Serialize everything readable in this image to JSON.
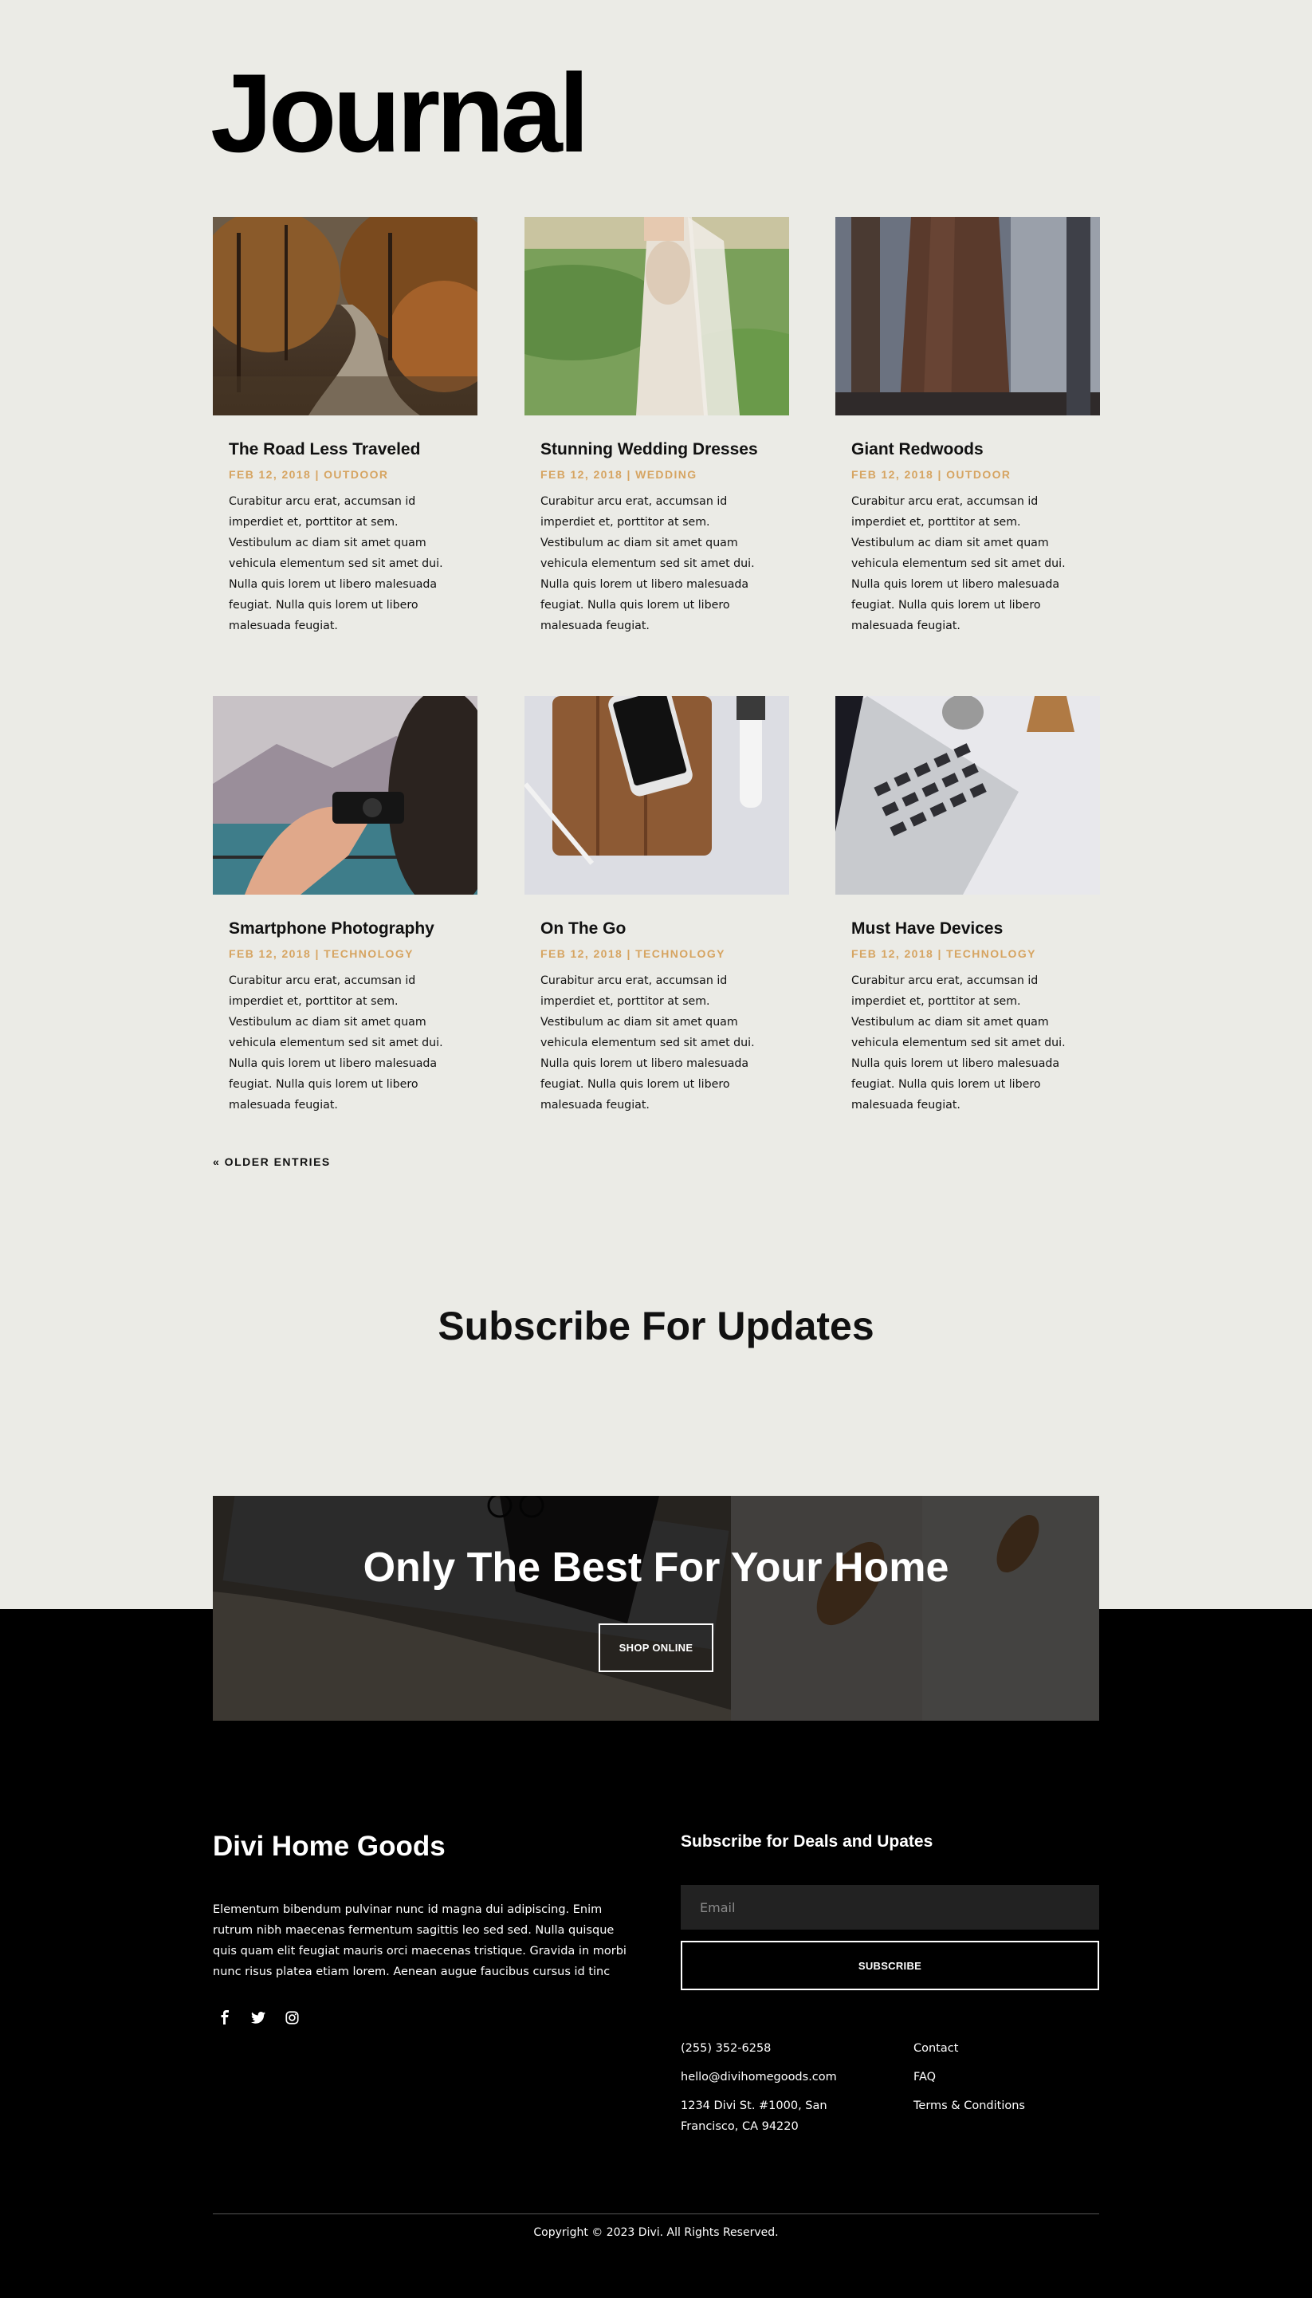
{
  "page": {
    "title": "Journal"
  },
  "posts": [
    {
      "title": "The Road Less Traveled",
      "meta": "FEB 12, 2018 | OUTDOOR",
      "excerpt": "Curabitur arcu erat, accumsan id imperdiet et, porttitor at sem. Vestibulum ac diam sit amet quam vehicula elementum sed sit amet dui. Nulla quis lorem ut libero malesuada feugiat. Nulla quis lorem ut libero malesuada feugiat."
    },
    {
      "title": "Stunning Wedding Dresses",
      "meta": "FEB 12, 2018 | WEDDING",
      "excerpt": "Curabitur arcu erat, accumsan id imperdiet et, porttitor at sem. Vestibulum ac diam sit amet quam vehicula elementum sed sit amet dui. Nulla quis lorem ut libero malesuada feugiat. Nulla quis lorem ut libero malesuada feugiat."
    },
    {
      "title": "Giant Redwoods",
      "meta": "FEB 12, 2018 | OUTDOOR",
      "excerpt": "Curabitur arcu erat, accumsan id imperdiet et, porttitor at sem. Vestibulum ac diam sit amet quam vehicula elementum sed sit amet dui. Nulla quis lorem ut libero malesuada feugiat. Nulla quis lorem ut libero malesuada feugiat."
    },
    {
      "title": "Smartphone Photography",
      "meta": "FEB 12, 2018 | TECHNOLOGY",
      "excerpt": "Curabitur arcu erat, accumsan id imperdiet et, porttitor at sem. Vestibulum ac diam sit amet quam vehicula elementum sed sit amet dui. Nulla quis lorem ut libero malesuada feugiat. Nulla quis lorem ut libero malesuada feugiat."
    },
    {
      "title": "On The Go",
      "meta": "FEB 12, 2018 | TECHNOLOGY",
      "excerpt": "Curabitur arcu erat, accumsan id imperdiet et, porttitor at sem. Vestibulum ac diam sit amet quam vehicula elementum sed sit amet dui. Nulla quis lorem ut libero malesuada feugiat. Nulla quis lorem ut libero malesuada feugiat."
    },
    {
      "title": "Must Have Devices",
      "meta": "FEB 12, 2018 | TECHNOLOGY",
      "excerpt": "Curabitur arcu erat, accumsan id imperdiet et, porttitor at sem. Vestibulum ac diam sit amet quam vehicula elementum sed sit amet dui. Nulla quis lorem ut libero malesuada feugiat. Nulla quis lorem ut libero malesuada feugiat."
    }
  ],
  "pagination": {
    "older": "« OLDER ENTRIES"
  },
  "subscribe": {
    "title": "Subscribe For Updates"
  },
  "banner": {
    "title": "Only The Best For Your Home",
    "button": "SHOP ONLINE"
  },
  "footer": {
    "brand": "Divi Home Goods",
    "about": "Elementum bibendum pulvinar nunc id magna dui adipiscing. Enim rutrum nibh maecenas fermentum sagittis leo sed sed. Nulla quisque quis quam elit feugiat mauris orci maecenas tristique. Gravida in morbi nunc risus platea etiam lorem. Aenean augue faucibus cursus id tinc",
    "socials": [
      "facebook-icon",
      "twitter-icon",
      "instagram-icon"
    ],
    "deals_title": "Subscribe for Deals and Upates",
    "email_placeholder": "Email",
    "subscribe_button": "SUBSCRIBE",
    "phone": "(255) 352-6258",
    "email": "hello@divihomegoods.com",
    "address": "1234 Divi St. #1000, San Francisco, CA 94220",
    "links": [
      "Contact",
      "FAQ",
      "Terms & Conditions"
    ],
    "copyright": "Copyright © 2023 Divi. All Rights Reserved."
  },
  "colors": {
    "page_bg": "#ebebe6",
    "accent": "#d6a461",
    "footer_bg": "#000000",
    "input_bg": "#222222"
  }
}
